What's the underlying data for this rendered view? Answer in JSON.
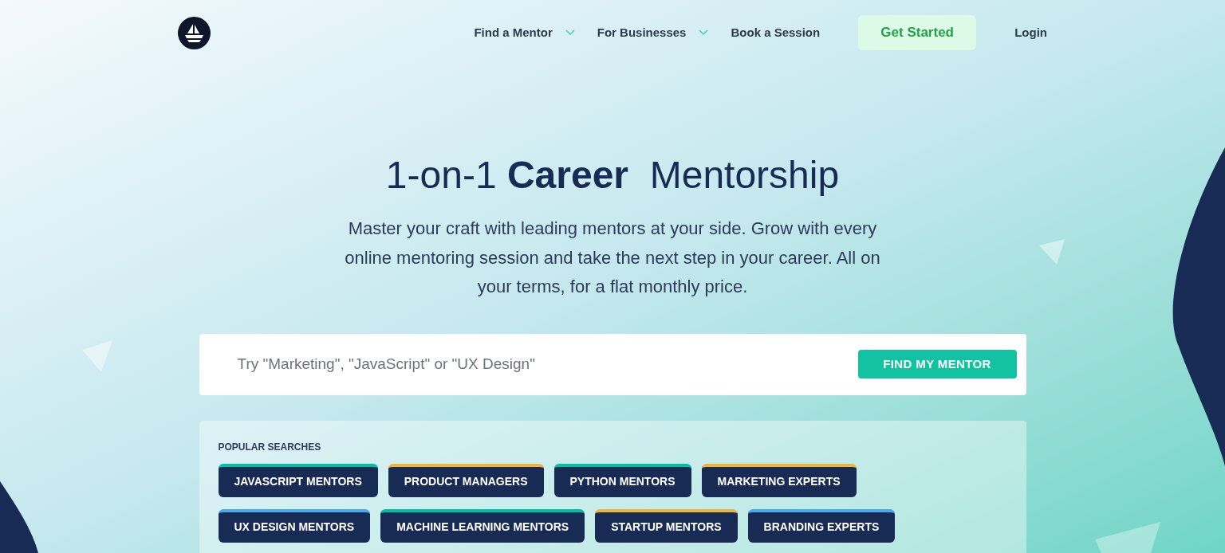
{
  "nav": {
    "items": [
      {
        "label": "Find a Mentor",
        "kind": "dropdown"
      },
      {
        "label": "For Businesses",
        "kind": "dropdown"
      },
      {
        "label": "Book a Session",
        "kind": "link"
      }
    ],
    "cta": "Get Started",
    "login": "Login"
  },
  "hero": {
    "title": "1-on-1 **Career**  Mentorship",
    "subtitle": "Master your craft with leading mentors at your side. Grow with every online mentoring session and take the next step in your career. All on your terms, for a flat monthly price."
  },
  "search": {
    "placeholder": "Try \"Marketing\", \"JavaScript\" or \"UX Design\"",
    "button": "FIND MY MENTOR"
  },
  "popular": {
    "heading": "POPULAR SEARCHES",
    "tags": [
      {
        "label": "JAVASCRIPT MENTORS",
        "color": "#00bfa5"
      },
      {
        "label": "PRODUCT MANAGERS",
        "color": "#f0b43c"
      },
      {
        "label": "PYTHON MENTORS",
        "color": "#00bfa5"
      },
      {
        "label": "MARKETING EXPERTS",
        "color": "#f0b43c"
      },
      {
        "label": "UX DESIGN MENTORS",
        "color": "#4aa8f0"
      },
      {
        "label": "MACHINE LEARNING MENTORS",
        "color": "#00bfa5"
      },
      {
        "label": "STARTUP MENTORS",
        "color": "#f0b43c"
      },
      {
        "label": "BRANDING EXPERTS",
        "color": "#4aa8f0"
      }
    ]
  }
}
